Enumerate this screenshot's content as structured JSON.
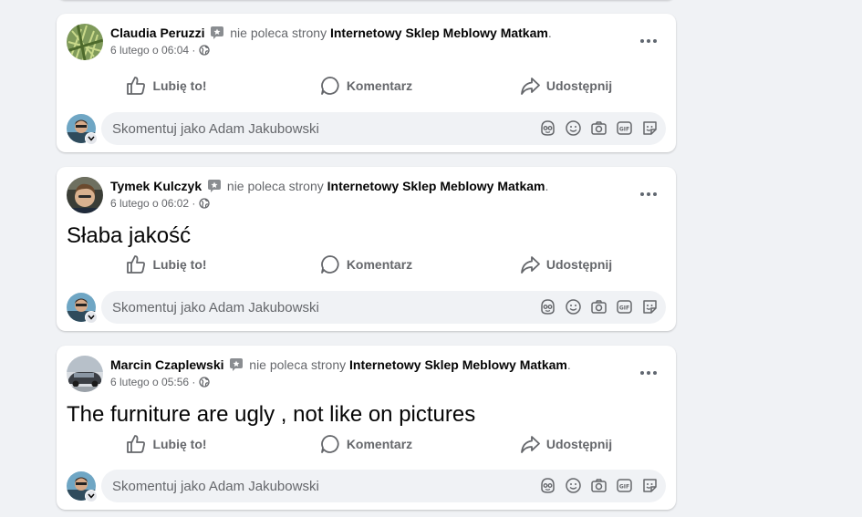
{
  "colors": {
    "background": "#f0f2f5",
    "card": "#ffffff",
    "muted": "#65676b",
    "text": "#050505"
  },
  "posts": [
    {
      "author": "Claudia Peruzzi",
      "verb": "nie poleca strony",
      "page": "Internetowy Sklep Meblowy Matkam",
      "period": ".",
      "time": "6 lutego o 06:04",
      "sep": "·",
      "text": ""
    },
    {
      "author": "Tymek Kulczyk",
      "verb": "nie poleca strony",
      "page": "Internetowy Sklep Meblowy Matkam",
      "period": ".",
      "time": "6 lutego o 06:02",
      "sep": "·",
      "text": "Słaba jakość"
    },
    {
      "author": "Marcin Czaplewski",
      "verb": "nie poleca strony",
      "page": "Internetowy Sklep Meblowy Matkam",
      "period": ".",
      "time": "6 lutego o 05:56",
      "sep": "·",
      "text": "The furniture are ugly , not like on pictures"
    }
  ],
  "actions": {
    "like": "Lubię to!",
    "comment": "Komentarz",
    "share": "Udostępnij"
  },
  "comment_box": {
    "placeholder": "Skomentuj jako Adam Jakubowski"
  },
  "icons": {
    "recommend": "no-recommend-icon",
    "globe": "globe-icon",
    "more": "more-icon",
    "like": "thumbs-up-icon",
    "comment": "comment-bubble-icon",
    "share": "share-arrow-icon",
    "comment_tools": [
      "avatar-sticker-icon",
      "emoji-icon",
      "camera-icon",
      "gif-icon",
      "sticker-icon"
    ]
  }
}
